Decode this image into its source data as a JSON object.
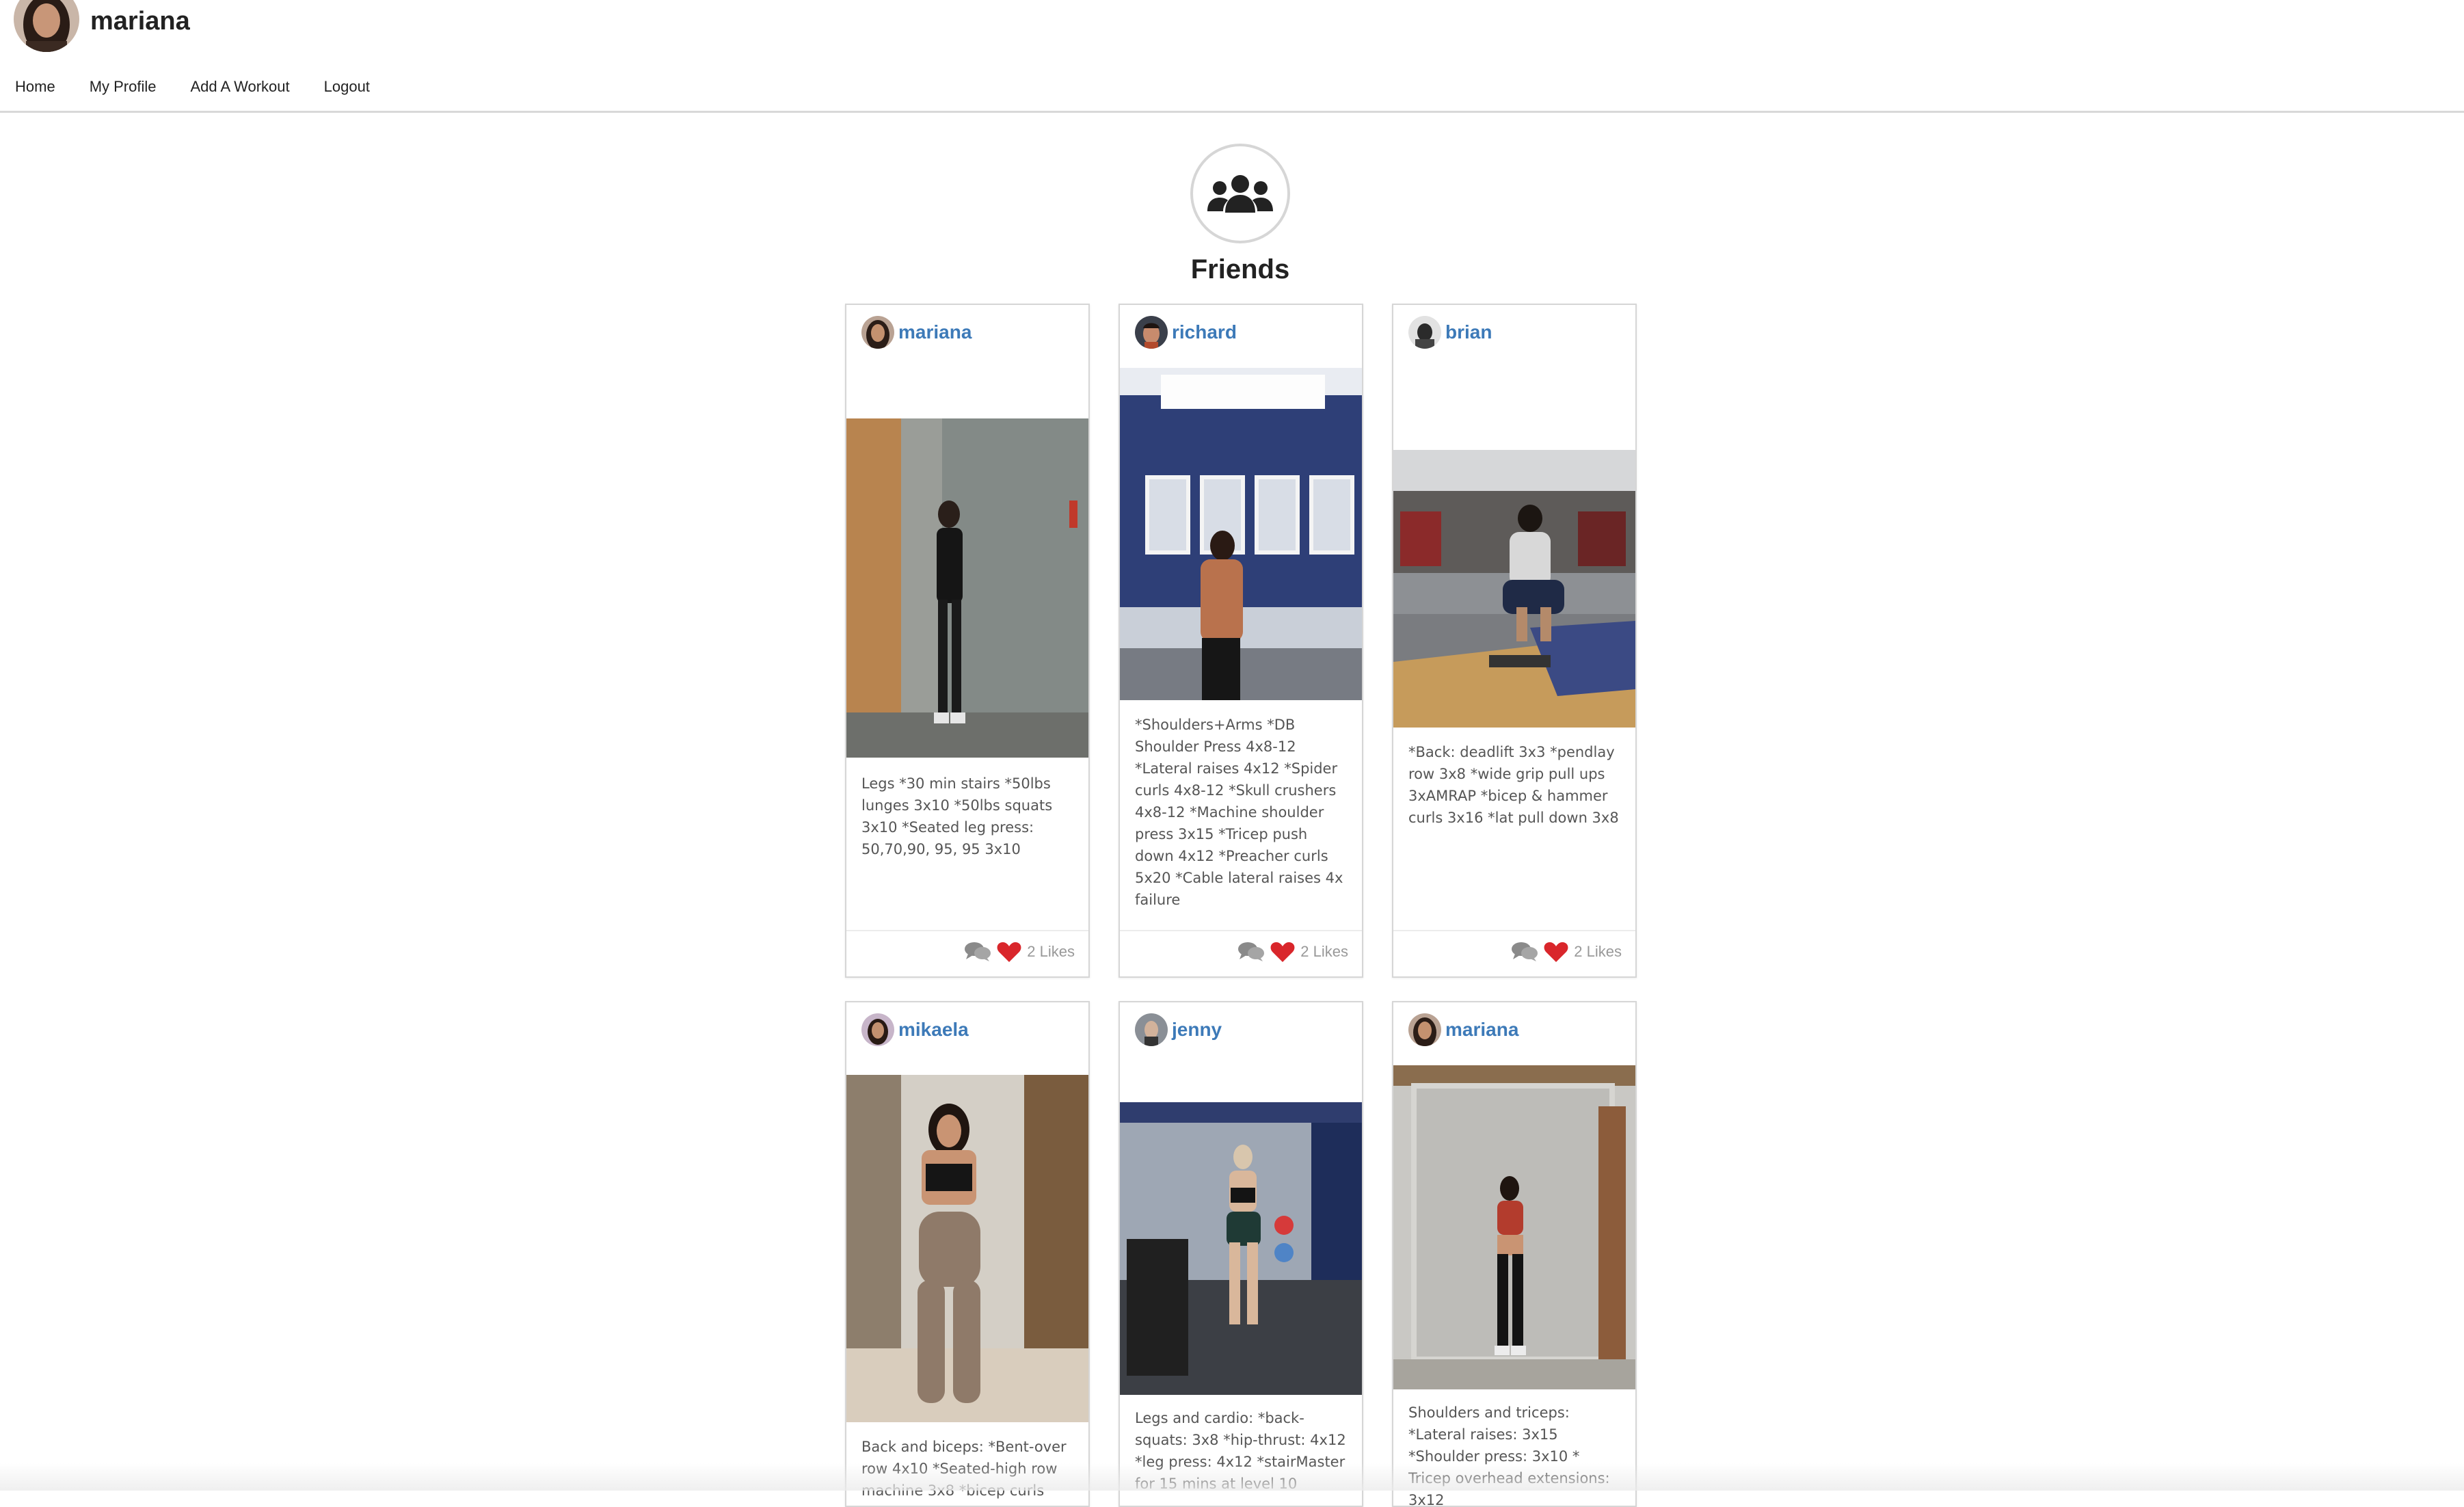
{
  "header": {
    "username": "mariana",
    "nav": [
      "Home",
      "My Profile",
      "Add A Workout",
      "Logout"
    ]
  },
  "friends_title": "Friends",
  "posts": [
    {
      "user": "mariana",
      "text": "Legs *30 min stairs *50lbs lunges 3x10 *50lbs squats 3x10 *Seated leg press: 50,70,90, 95, 95 3x10",
      "likes": "2 Likes"
    },
    {
      "user": "richard",
      "text": "*Shoulders+Arms *DB Shoulder Press 4x8-12 *Lateral raises 4x12 *Spider curls 4x8-12 *Skull crushers 4x8-12 *Machine shoulder press 3x15 *Tricep push down 4x12 *Preacher curls 5x20 *Cable lateral raises 4x failure",
      "likes": "2 Likes"
    },
    {
      "user": "brian",
      "text": "*Back: deadlift 3x3 *pendlay row 3x8 *wide grip pull ups 3xAMRAP *bicep & hammer curls 3x16 *lat pull down 3x8",
      "likes": "2 Likes"
    },
    {
      "user": "mikaela",
      "text": "Back and biceps: *Bent-over row 4x10 *Seated-high row machine 3x8 *bicep curls"
    },
    {
      "user": "jenny",
      "text": "Legs and cardio: *back-squats: 3x8 *hip-thrust: 4x12 *leg press: 4x12 *stairMaster for 15 mins at level 10"
    },
    {
      "user": "mariana",
      "text": "Shoulders and triceps: *Lateral raises: 3x15 *Shoulder press: 3x10 * Tricep overhead extensions: 3x12"
    }
  ],
  "icons": {
    "friends": "users-group-icon",
    "comment": "comments-icon",
    "like": "heart-icon"
  },
  "colors": {
    "username_link": "#3d7ab8",
    "heart": "#d9262b",
    "comment": "#8a8a8a"
  }
}
